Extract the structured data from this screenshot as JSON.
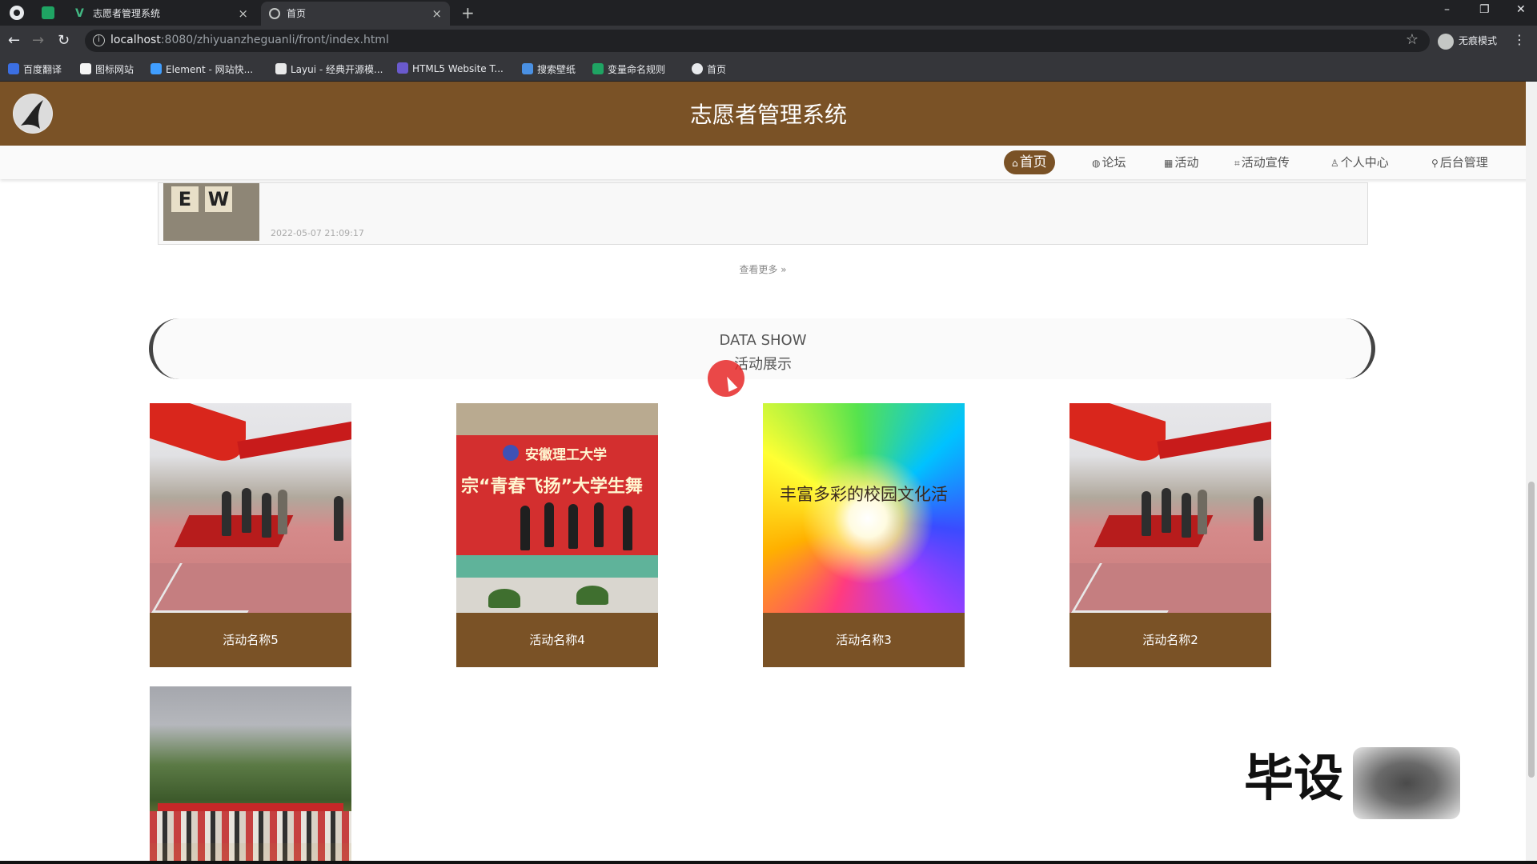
{
  "browser": {
    "tabs": [
      {
        "title": "志愿者管理系统"
      },
      {
        "title": "首页"
      }
    ],
    "close_glyph": "×",
    "new_tab_glyph": "+",
    "address": {
      "host": "localhost",
      "path": ":8080/zhiyuanzheguanli/front/index.html"
    },
    "profile_label": "无痕模式",
    "bookmarks": [
      {
        "label": "百度翻译",
        "color": "#3b6fe3"
      },
      {
        "label": "图标网站",
        "color": "#f5f5f5"
      },
      {
        "label": "Element - 网站快...",
        "color": "#409eff"
      },
      {
        "label": "Layui - 经典开源模...",
        "color": "#e8e8e8"
      },
      {
        "label": "HTML5 Website T...",
        "color": "#6a5acd"
      },
      {
        "label": "搜索壁纸",
        "color": "#4a90e2"
      },
      {
        "label": "变量命名规则",
        "color": "#1fa463"
      },
      {
        "label": "首页",
        "color": "#e8eaed"
      }
    ]
  },
  "site": {
    "title": "志愿者管理系统",
    "accent_color": "#7a5226",
    "nav": [
      {
        "icon": "⌂",
        "label": "首页",
        "active": true
      },
      {
        "icon": "◍",
        "label": "论坛"
      },
      {
        "icon": "▦",
        "label": "活动"
      },
      {
        "icon": "⌗",
        "label": "活动宣传"
      },
      {
        "icon": "♙",
        "label": "个人中心"
      },
      {
        "icon": "⚲",
        "label": "后台管理"
      }
    ]
  },
  "news": {
    "thumb_letters": [
      "E",
      "W"
    ],
    "date": "2022-05-07 21:09:17",
    "view_more": "查看更多"
  },
  "section": {
    "en": "DATA SHOW",
    "cn": "活动展示"
  },
  "activities": [
    {
      "name": "活动名称5"
    },
    {
      "name": "活动名称4",
      "school": "安徽理工大学",
      "slogan": "宗“青春飞扬”大学生舞"
    },
    {
      "name": "活动名称3",
      "poster_text": "丰富多彩的校园文化活"
    },
    {
      "name": "活动名称2"
    },
    {
      "name": ""
    }
  ],
  "watermark": "毕设"
}
